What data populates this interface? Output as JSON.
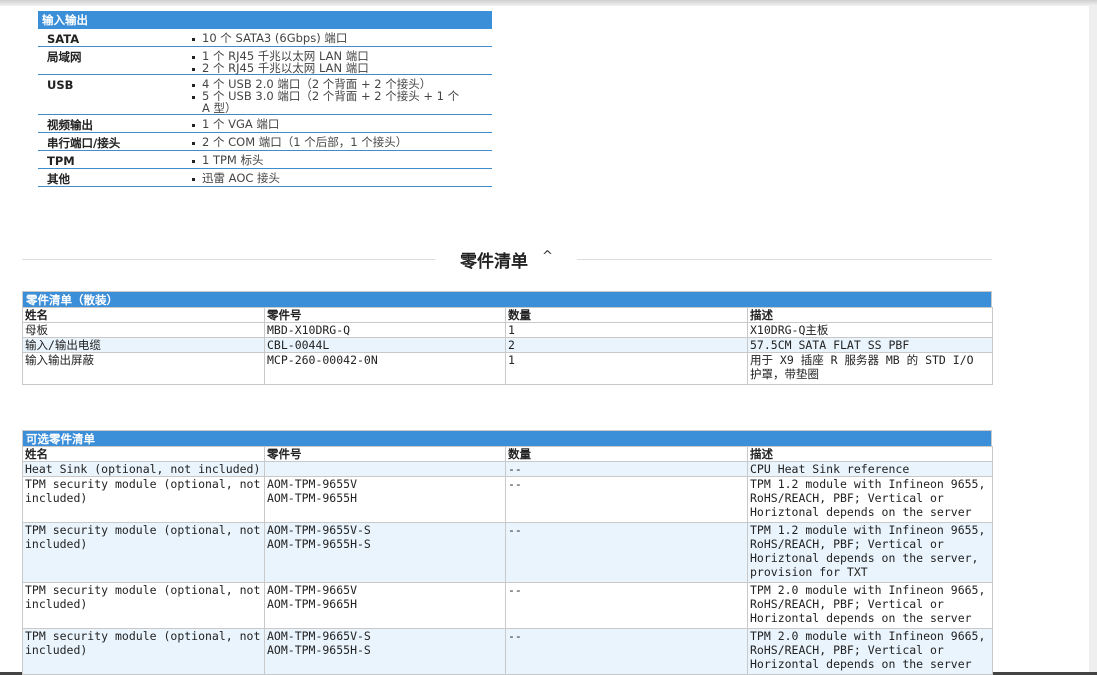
{
  "io": {
    "header": "输入输出",
    "rows": [
      {
        "label": "SATA",
        "values": [
          "10 个 SATA3 (6Gbps) 端口"
        ]
      },
      {
        "label": "局域网",
        "values": [
          "1 个 RJ45 千兆以太网 LAN 端口",
          "2 个 RJ45 千兆以太网 LAN 端口"
        ]
      },
      {
        "label": "USB",
        "values": [
          "4 个 USB 2.0 端口（2 个背面 + 2 个接头）",
          "5 个 USB 3.0 端口（2 个背面 + 2 个接头 + 1 个 A 型）"
        ]
      },
      {
        "label": "视频输出",
        "values": [
          "1 个 VGA 端口"
        ]
      },
      {
        "label": "串行端口/接头",
        "values": [
          "2 个 COM 端口（1 个后部，1 个接头）"
        ]
      },
      {
        "label": "TPM",
        "values": [
          "1 TPM 标头"
        ]
      },
      {
        "label": "其他",
        "values": [
          "迅雷 AOC 接头"
        ]
      }
    ]
  },
  "section": {
    "title": "零件清单",
    "chevron": "^"
  },
  "parts": {
    "header": "零件清单（散装）",
    "columns": [
      "姓名",
      "零件号",
      "数量",
      "描述"
    ],
    "rows": [
      [
        "母板",
        "MBD-X10DRG-Q",
        "1",
        "X10DRG-Q主板"
      ],
      [
        "输入/输出电缆",
        "CBL-0044L",
        "2",
        "57.5CM SATA FLAT SS PBF"
      ],
      [
        "输入输出屏蔽",
        "MCP-260-00042-0N",
        "1",
        "用于 X9 插座 R 服务器 MB 的 STD I/O 护罩，带垫圈"
      ]
    ]
  },
  "optional": {
    "header": "可选零件清单",
    "columns": [
      "姓名",
      "零件号",
      "数量",
      "描述"
    ],
    "rows": [
      [
        "Heat Sink (optional, not included)",
        "",
        "--",
        "CPU Heat Sink reference"
      ],
      [
        "TPM security module (optional, not included)",
        "AOM-TPM-9655V\nAOM-TPM-9655H",
        "--",
        "TPM 1.2 module with Infineon 9655, RoHS/REACH, PBF; Vertical or Horiztonal depends on the server"
      ],
      [
        "TPM security module (optional, not included)",
        "AOM-TPM-9655V-S\nAOM-TPM-9655H-S",
        "--",
        "TPM 1.2 module with Infineon 9655, RoHS/REACH, PBF; Vertical or Horiztonal depends on the server, provision for TXT"
      ],
      [
        "TPM security module (optional, not included)",
        "AOM-TPM-9665V\nAOM-TPM-9665H",
        "--",
        "TPM 2.0 module with Infineon 9665, RoHS/REACH, PBF; Vertical or Horizontal depends on the server"
      ],
      [
        "TPM security module (optional, not included)",
        "AOM-TPM-9665V-S\nAOM-TPM-9655H-S",
        "--",
        "TPM 2.0 module with Infineon 9665, RoHS/REACH, PBF; Vertical or Horizontal depends on the server"
      ]
    ]
  }
}
